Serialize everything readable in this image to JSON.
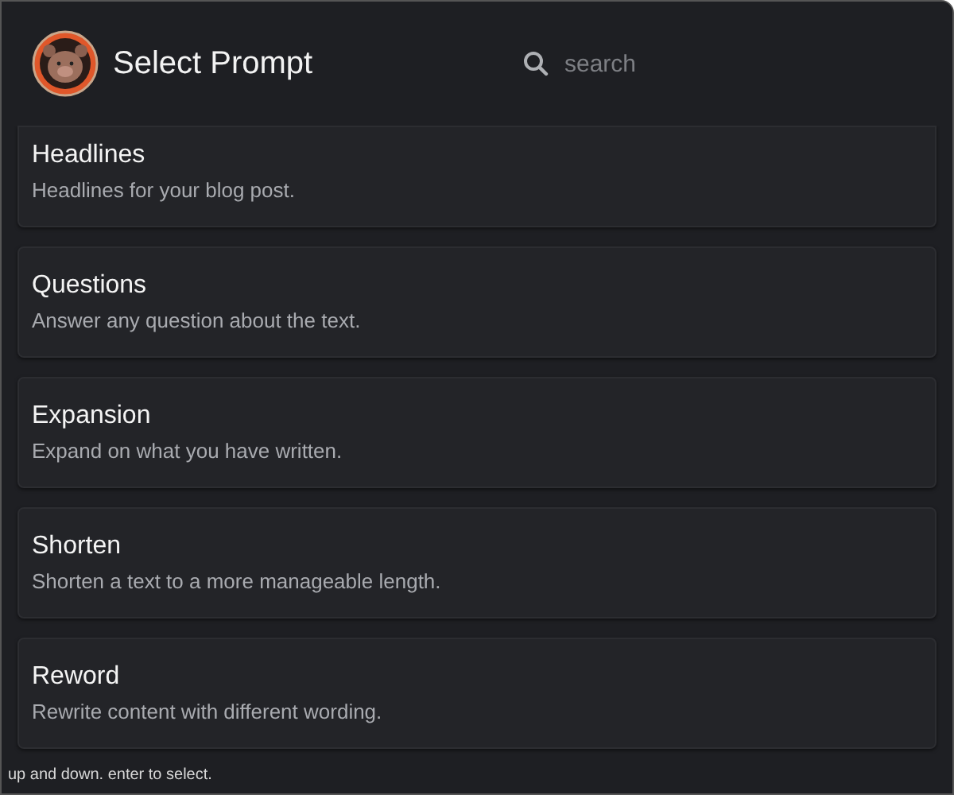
{
  "header": {
    "title": "Select Prompt",
    "search": {
      "placeholder": "search"
    }
  },
  "prompts": [
    {
      "title": "Headlines",
      "description": "Headlines for your blog post."
    },
    {
      "title": "Questions",
      "description": "Answer any question about the text."
    },
    {
      "title": "Expansion",
      "description": "Expand on what you have written."
    },
    {
      "title": "Shorten",
      "description": "Shorten a text to a more manageable length."
    },
    {
      "title": "Reword",
      "description": "Rewrite content with different wording."
    }
  ],
  "footer": {
    "hint": "up and down. enter to select."
  }
}
